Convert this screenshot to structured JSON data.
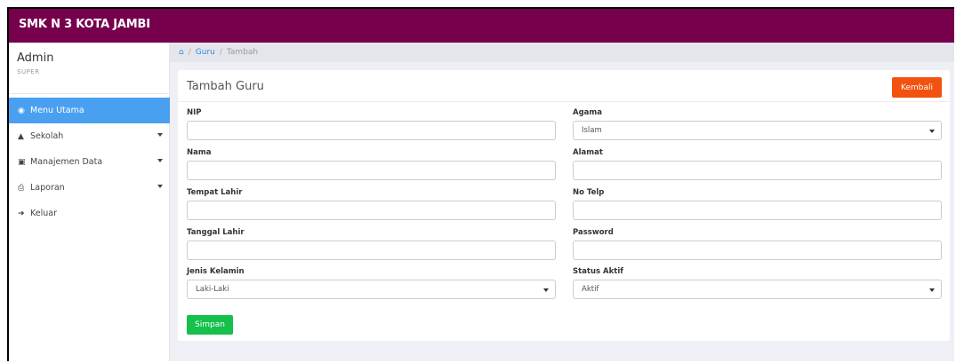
{
  "app": {
    "brand": "SMK N 3 KOTA JAMBI"
  },
  "user": {
    "name": "Admin",
    "role": "SUPER"
  },
  "sidebar": {
    "items": [
      {
        "label": "Menu Utama",
        "icon": "dashboard-icon",
        "active": true,
        "has_caret": false
      },
      {
        "label": "Sekolah",
        "icon": "bank-icon",
        "active": false,
        "has_caret": true
      },
      {
        "label": "Manajemen Data",
        "icon": "database-icon",
        "active": false,
        "has_caret": true
      },
      {
        "label": "Laporan",
        "icon": "print-icon",
        "active": false,
        "has_caret": true
      },
      {
        "label": "Keluar",
        "icon": "sign-out-icon",
        "active": false,
        "has_caret": false
      }
    ]
  },
  "breadcrumb": {
    "home_icon": "home-icon",
    "link": "Guru",
    "current": "Tambah"
  },
  "panel": {
    "title": "Tambah Guru",
    "back_label": "Kembali",
    "save_label": "Simpan"
  },
  "form": {
    "nip": {
      "label": "NIP",
      "value": ""
    },
    "nama": {
      "label": "Nama",
      "value": ""
    },
    "tempat_lahir": {
      "label": "Tempat Lahir",
      "value": ""
    },
    "tanggal_lahir": {
      "label": "Tanggal Lahir",
      "value": ""
    },
    "jenis_kelamin": {
      "label": "Jenis Kelamin",
      "value": "Laki-Laki"
    },
    "agama": {
      "label": "Agama",
      "value": "Islam"
    },
    "alamat": {
      "label": "Alamat",
      "value": ""
    },
    "no_telp": {
      "label": "No Telp",
      "value": ""
    },
    "password": {
      "label": "Password",
      "value": ""
    },
    "status_aktif": {
      "label": "Status Aktif",
      "value": "Aktif"
    }
  },
  "colors": {
    "topbar": "#77004d",
    "active_menu": "#4aa0f0",
    "back_button": "#f2520f",
    "save_button": "#15c04b",
    "link": "#2a8de0"
  }
}
